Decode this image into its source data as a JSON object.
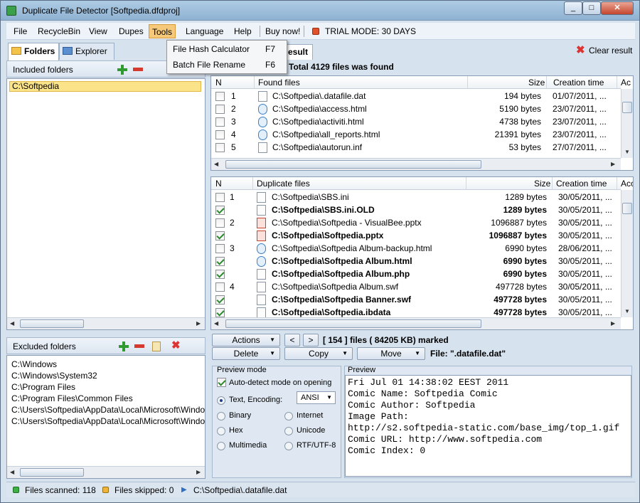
{
  "window": {
    "title": "Duplicate File Detector [Softpedia.dfdproj]",
    "min": "_",
    "max": "□",
    "close": "✕"
  },
  "menu": {
    "items": [
      "File",
      "RecycleBin",
      "View",
      "Dupes",
      "Tools",
      "Language",
      "Help",
      "Buy now!"
    ],
    "trial": "TRIAL MODE: 30 DAYS"
  },
  "tools_menu": {
    "items": [
      {
        "label": "File Hash Calculator",
        "key": "F7"
      },
      {
        "label": "Batch File Rename",
        "key": "F6"
      }
    ]
  },
  "left": {
    "tabs": [
      "Folders",
      "Explorer"
    ],
    "included": {
      "title": "Included folders",
      "items": [
        "C:\\Softpedia"
      ]
    },
    "excluded": {
      "title": "Excluded folders",
      "items": [
        "C:\\Windows",
        "C:\\Windows\\System32",
        "C:\\Program Files",
        "C:\\Program Files\\Common Files",
        "C:\\Users\\Softpedia\\AppData\\Local\\Microsoft\\Windows\\",
        "C:\\Users\\Softpedia\\AppData\\Local\\Microsoft\\Windows\\"
      ]
    }
  },
  "result": {
    "tab_partial": "esult",
    "clear": "Clear result",
    "total": "Total 4129 files was found"
  },
  "found": {
    "headers": [
      "N",
      "Found files",
      "Size",
      "Creation time",
      "Ac"
    ],
    "rows": [
      {
        "n": "1",
        "name": "C:\\Softpedia\\.datafile.dat",
        "size": "194 bytes",
        "time": "01/07/2011, ...",
        "selected": true
      },
      {
        "n": "2",
        "name": "C:\\Softpedia\\access.html",
        "size": "5190 bytes",
        "time": "23/07/2011, ..."
      },
      {
        "n": "3",
        "name": "C:\\Softpedia\\activiti.html",
        "size": "4738 bytes",
        "time": "23/07/2011, ..."
      },
      {
        "n": "4",
        "name": "C:\\Softpedia\\all_reports.html",
        "size": "21391 bytes",
        "time": "23/07/2011, ..."
      },
      {
        "n": "5",
        "name": "C:\\Softpedia\\autorun.inf",
        "size": "53 bytes",
        "time": "27/07/2011, ..."
      }
    ]
  },
  "dups": {
    "headers": [
      "N",
      "Duplicate files",
      "Size",
      "Creation time",
      "Acce"
    ],
    "rows": [
      {
        "n": "1",
        "name": "C:\\Softpedia\\SBS.ini",
        "size": "1289 bytes",
        "time": "30/05/2011, ...",
        "checked": false,
        "bold": false
      },
      {
        "n": "",
        "name": "C:\\Softpedia\\SBS.ini.OLD",
        "size": "1289 bytes",
        "time": "30/05/2011, ...",
        "checked": true,
        "bold": true
      },
      {
        "n": "2",
        "name": "C:\\Softpedia\\Softpedia - VisualBee.pptx",
        "size": "1096887 bytes",
        "time": "30/05/2011, ...",
        "checked": false,
        "bold": false
      },
      {
        "n": "",
        "name": "C:\\Softpedia\\Softpedia.pptx",
        "size": "1096887 bytes",
        "time": "30/05/2011, ...",
        "checked": true,
        "bold": true
      },
      {
        "n": "3",
        "name": "C:\\Softpedia\\Softpedia Album-backup.html",
        "size": "6990 bytes",
        "time": "28/06/2011, ...",
        "checked": false,
        "bold": false
      },
      {
        "n": "",
        "name": "C:\\Softpedia\\Softpedia Album.html",
        "size": "6990 bytes",
        "time": "30/05/2011, ...",
        "checked": true,
        "bold": true
      },
      {
        "n": "",
        "name": "C:\\Softpedia\\Softpedia Album.php",
        "size": "6990 bytes",
        "time": "30/05/2011, ...",
        "checked": true,
        "bold": true
      },
      {
        "n": "4",
        "name": "C:\\Softpedia\\Softpedia Album.swf",
        "size": "497728 bytes",
        "time": "30/05/2011, ...",
        "checked": false,
        "bold": false
      },
      {
        "n": "",
        "name": "C:\\Softpedia\\Softpedia Banner.swf",
        "size": "497728 bytes",
        "time": "30/05/2011, ...",
        "checked": true,
        "bold": true
      },
      {
        "n": "",
        "name": "C:\\Softpedia\\Softpedia.ibdata",
        "size": "497728 bytes",
        "time": "30/05/2011, ...",
        "checked": true,
        "bold": true
      }
    ]
  },
  "actions": {
    "actions": "Actions",
    "delete": "Delete",
    "copy": "Copy",
    "move": "Move",
    "prev": "<",
    "next": ">",
    "marked": "[ 154 ] files ( 84205 KB) marked",
    "file": "File: \".datafile.dat\""
  },
  "preview_mode": {
    "title": "Preview mode",
    "auto": "Auto-detect mode on opening",
    "text_enc": "Text, Encoding:",
    "encoding": "ANSI",
    "binary": "Binary",
    "internet": "Internet",
    "hex": "Hex",
    "unicode": "Unicode",
    "multimedia": "Multimedia",
    "rtf": "RTF/UTF-8"
  },
  "preview": {
    "title": "Preview",
    "text": "Fri Jul 01 14:38:02 EEST 2011\nComic Name: Softpedia Comic\nComic Author: Softpedia\nImage Path:\nhttp://s2.softpedia-static.com/base_img/top_1.gif\nComic URL: http://www.softpedia.com\nComic Index: 0"
  },
  "status": {
    "scanned": "Files scanned: 118",
    "skipped": "Files skipped: 0",
    "current": "C:\\Softpedia\\.datafile.dat"
  },
  "colors": {
    "accent": "#3398ea",
    "menu_active": "#f6c97a",
    "included_sel": "#fbe38a"
  }
}
